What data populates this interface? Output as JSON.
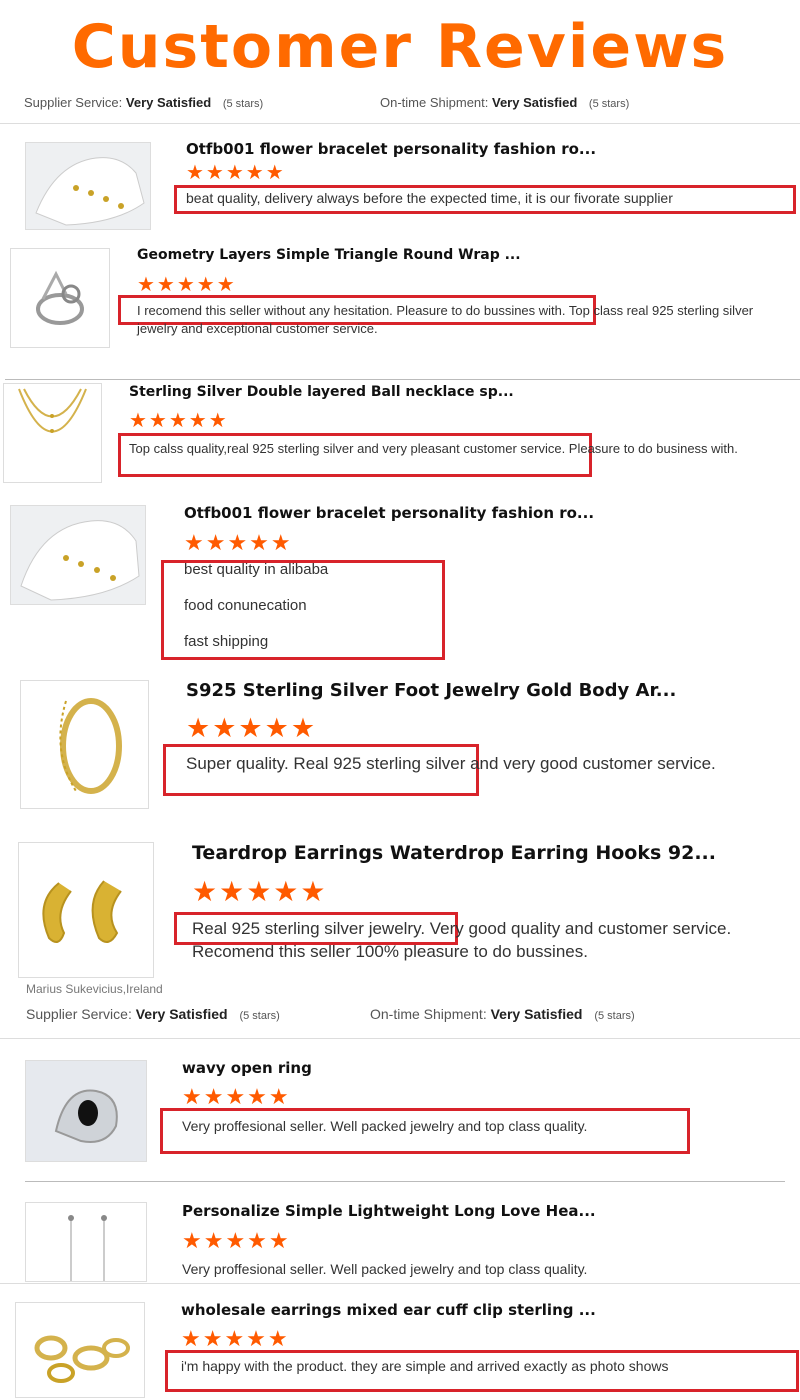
{
  "header": {
    "title": "Customer Reviews",
    "supplier_service_label": "Supplier Service:",
    "supplier_service_value": "Very Satisfied",
    "supplier_service_stars": "(5 stars)",
    "shipment_label": "On-time Shipment:",
    "shipment_value": "Very Satisfied",
    "shipment_stars": "(5 stars)"
  },
  "reviews": [
    {
      "title": "Otfb001 flower bracelet personality fashion ro...",
      "stars": "★★★★★",
      "rating": 5,
      "text": "beat quality, delivery always before the expected time, it is our fivorate supplier",
      "image": "bracelet-on-glove-thumbnail"
    },
    {
      "title": "Geometry Layers Simple Triangle Round Wrap ...",
      "stars": "★★★★★",
      "rating": 5,
      "text": "I recomend this seller without any hesitation. Pleasure to do bussines with. Top class real 925 sterling silver jewelry and exceptional customer service.",
      "image": "silver-wrap-ring-thumbnail"
    },
    {
      "title": "Sterling Silver Double layered Ball necklace sp...",
      "stars": "★★★★★",
      "rating": 5,
      "text": "Top calss quality,real 925 sterling silver and very pleasant customer service. Pleasure to do business with.",
      "image": "gold-layered-necklace-thumbnail"
    },
    {
      "title": "Otfb001 flower bracelet personality fashion ro...",
      "stars": "★★★★★",
      "rating": 5,
      "lines": [
        "best quality in alibaba",
        "food conunecation",
        "fast shipping"
      ],
      "image": "bracelet-on-glove-thumbnail"
    },
    {
      "title": "S925 Sterling Silver Foot Jewelry Gold Body Ar...",
      "stars": "★★★★★",
      "rating": 5,
      "text": "Super quality. Real 925 sterling silver and very good customer service.",
      "image": "gold-bangle-chain-thumbnail"
    },
    {
      "title": "Teardrop Earrings Waterdrop Earring Hooks 92...",
      "stars": "★★★★★",
      "rating": 5,
      "text": "Real 925 sterling silver jewelry. Very good quality and customer service. Recomend this seller 100% pleasure to do bussines.",
      "image": "gold-teardrop-earrings-thumbnail",
      "reviewer": "Marius Sukevicius,Ireland"
    },
    {
      "title": "wavy open ring",
      "stars": "★★★★★",
      "rating": 5,
      "text": "Very proffesional seller. Well packed jewelry and top class quality.",
      "image": "wavy-open-ring-thumbnail"
    },
    {
      "title": "Personalize Simple Lightweight Long Love Hea...",
      "stars": "★★★★★",
      "rating": 5,
      "text": "Very proffesional seller. Well packed jewelry and top class quality.",
      "image": "long-heart-earrings-thumbnail"
    },
    {
      "title": "wholesale earrings mixed ear cuff clip sterling ...",
      "stars": "★★★★★",
      "rating": 5,
      "text": "i'm happy with the product. they are simple and arrived exactly as photo shows",
      "image": "gold-ear-cuffs-thumbnail"
    }
  ],
  "footer_ratings": {
    "supplier_service_label": "Supplier Service:",
    "supplier_service_value": "Very Satisfied",
    "supplier_service_stars": "(5 stars)",
    "shipment_label": "On-time Shipment:",
    "shipment_value": "Very Satisfied",
    "shipment_stars": "(5 stars)"
  },
  "colors": {
    "accent": "#ff6a00",
    "star": "#ff5a00",
    "highlight_box": "#d8232a"
  }
}
